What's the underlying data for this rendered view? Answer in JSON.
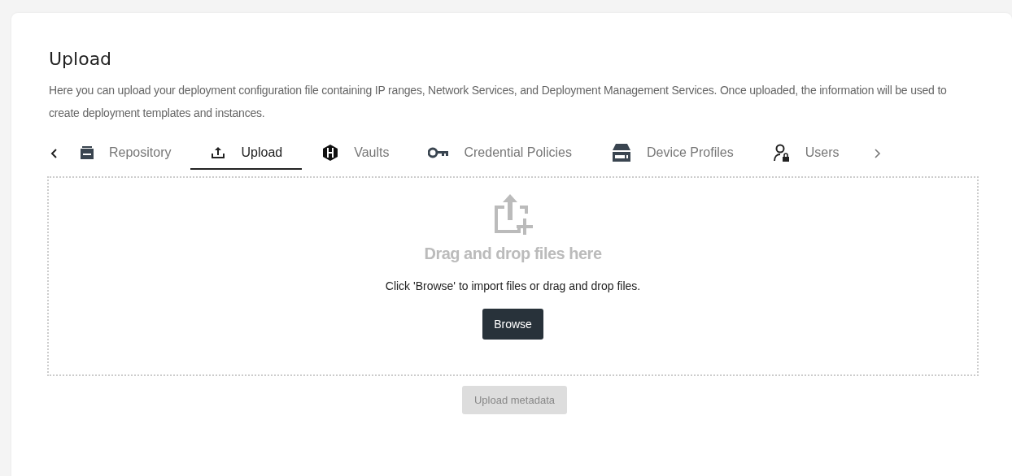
{
  "page": {
    "title": "Upload",
    "description": "Here you can upload your deployment configuration file containing IP ranges, Network Services, and Deployment Management Services. Once uploaded, the information will be used to create deployment templates and instances."
  },
  "tabs": [
    {
      "kind": "repository",
      "label": "Repository",
      "selected": false
    },
    {
      "kind": "upload",
      "label": "Upload",
      "selected": true
    },
    {
      "kind": "vaults",
      "label": "Vaults",
      "selected": false
    },
    {
      "kind": "credential",
      "label": "Credential Policies",
      "selected": false
    },
    {
      "kind": "device",
      "label": "Device Profiles",
      "selected": false
    },
    {
      "kind": "users",
      "label": "Users",
      "selected": false
    }
  ],
  "dropzone": {
    "heading": "Drag and drop files here",
    "hint": "Click 'Browse' to import files or drag and drop files.",
    "button": "Browse"
  },
  "submit": {
    "label": "Upload metadata",
    "disabled": true
  }
}
